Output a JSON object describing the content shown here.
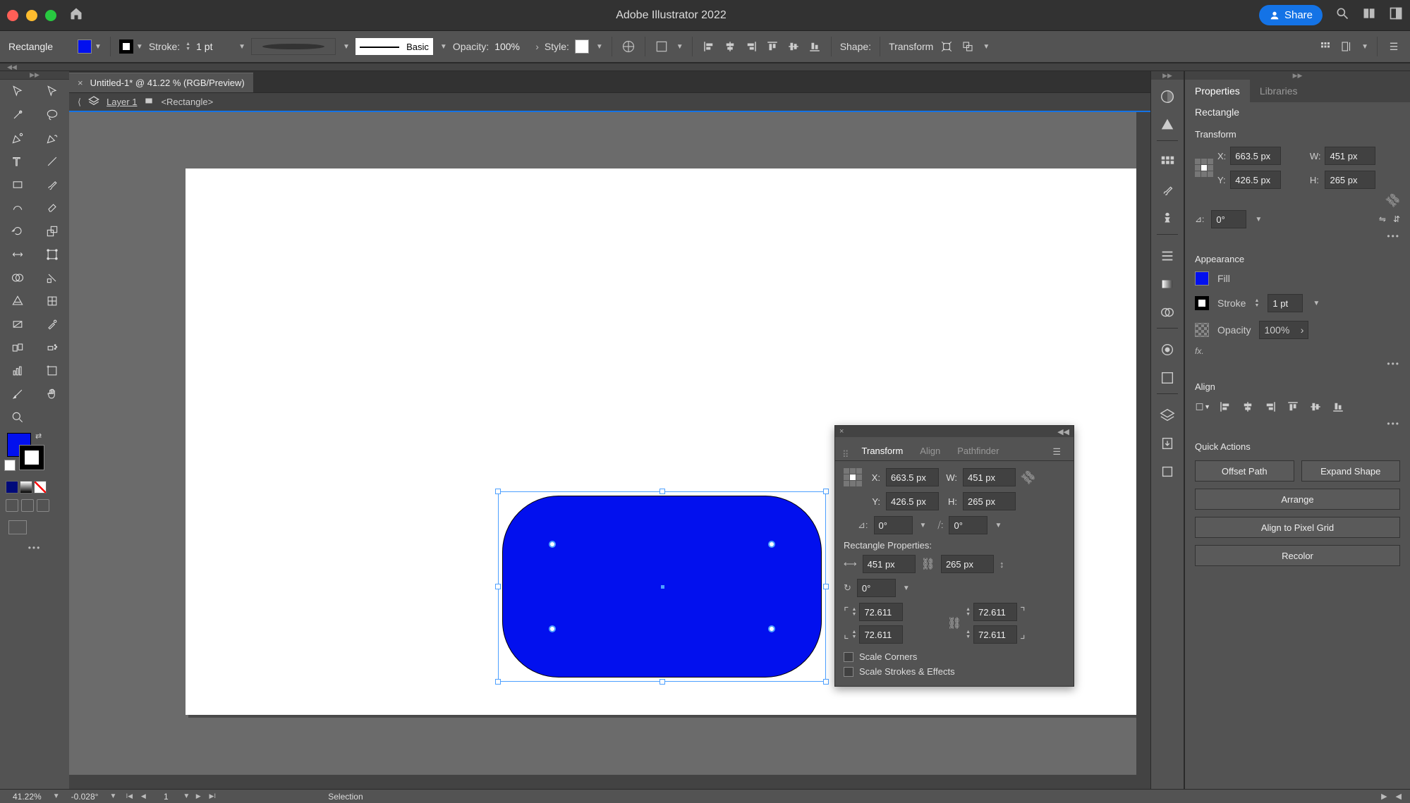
{
  "app": {
    "title": "Adobe Illustrator 2022"
  },
  "share_label": "Share",
  "controlbar": {
    "object_type": "Rectangle",
    "stroke_label": "Stroke:",
    "stroke_pt": "1 pt",
    "brush_name": "Basic",
    "opacity_label": "Opacity:",
    "opacity_value": "100%",
    "style_label": "Style:",
    "shape_label": "Shape:",
    "transform_label": "Transform"
  },
  "doc_tab": {
    "title": "Untitled-1* @ 41.22 % (RGB/Preview)"
  },
  "breadcrumb": {
    "layer": "Layer 1",
    "object": "<Rectangle>"
  },
  "transform_panel": {
    "tabs": {
      "transform": "Transform",
      "align": "Align",
      "pathfinder": "Pathfinder"
    },
    "x": "663.5 px",
    "y": "426.5 px",
    "w": "451 px",
    "h": "265 px",
    "rotate": "0°",
    "shear": "0°",
    "rect_props_label": "Rectangle Properties:",
    "rect_w": "451 px",
    "rect_h": "265 px",
    "rect_angle": "0°",
    "corner_tl": "72.611",
    "corner_tr": "72.611",
    "corner_bl": "72.611",
    "corner_br": "72.611",
    "scale_corners": "Scale Corners",
    "scale_strokes": "Scale Strokes & Effects"
  },
  "properties": {
    "tabs": {
      "properties": "Properties",
      "libraries": "Libraries"
    },
    "object_type": "Rectangle",
    "transform_label": "Transform",
    "x_label": "X:",
    "y_label": "Y:",
    "w_label": "W:",
    "h_label": "H:",
    "x": "663.5 px",
    "y": "426.5 px",
    "w": "451 px",
    "h": "265 px",
    "angle": "0°",
    "appearance_label": "Appearance",
    "fill_label": "Fill",
    "stroke_label": "Stroke",
    "stroke_pt": "1 pt",
    "opacity_label": "Opacity",
    "opacity_value": "100%",
    "fx_label": "fx.",
    "align_label": "Align",
    "quick_actions_label": "Quick Actions",
    "btn_offset": "Offset Path",
    "btn_expand": "Expand Shape",
    "btn_arrange": "Arrange",
    "btn_pixelgrid": "Align to Pixel Grid",
    "btn_recolor": "Recolor"
  },
  "statusbar": {
    "zoom": "41.22%",
    "rotation": "-0.028°",
    "artboard_num": "1",
    "tool": "Selection"
  }
}
